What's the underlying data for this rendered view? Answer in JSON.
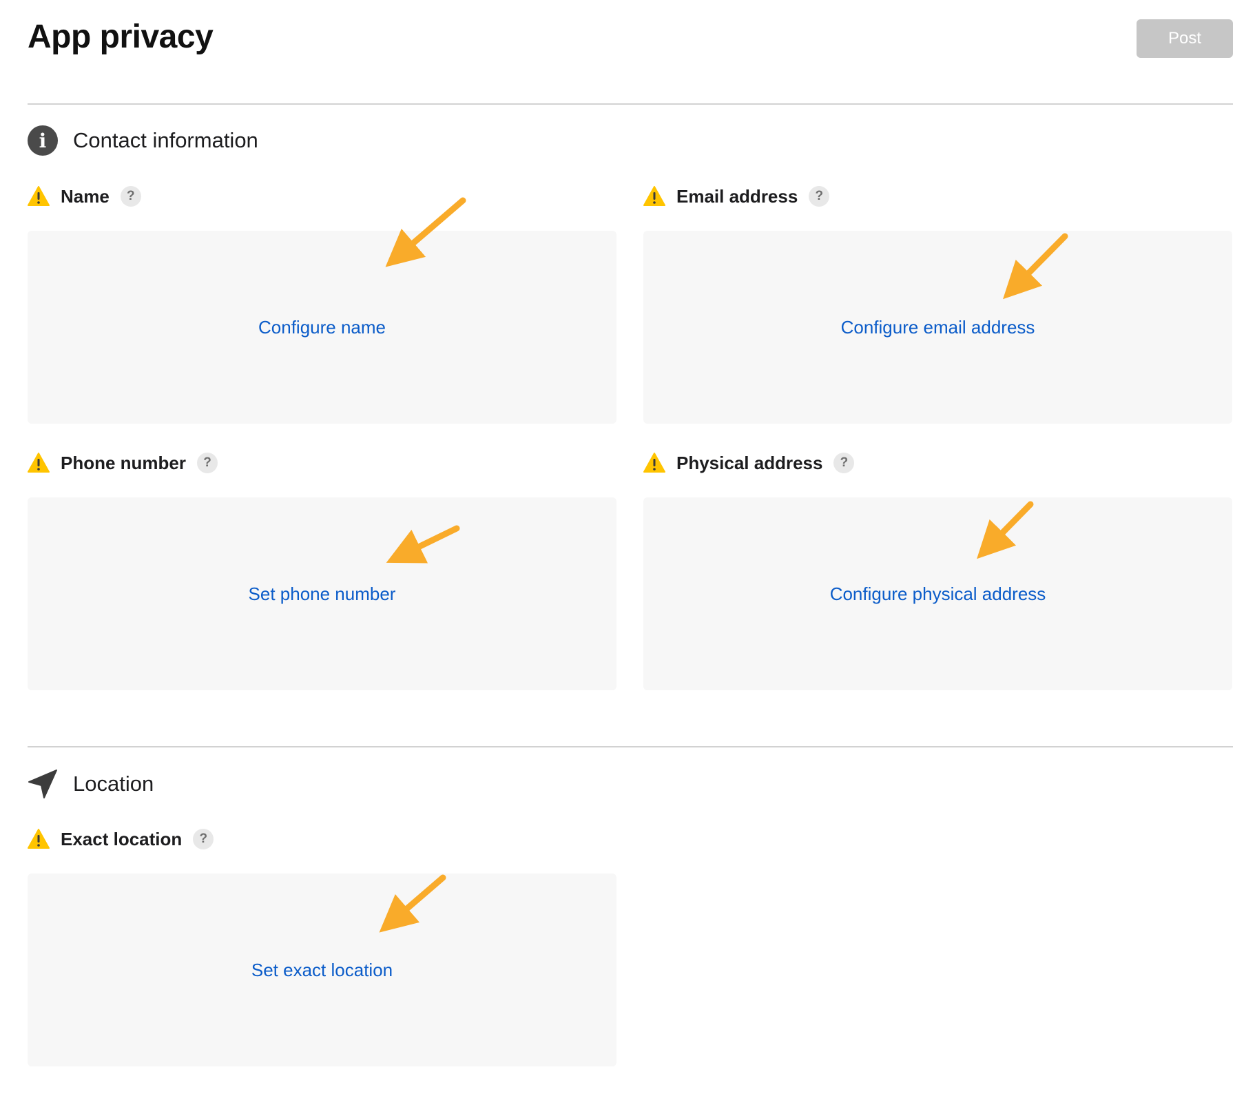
{
  "header": {
    "title": "App privacy",
    "post_label": "Post"
  },
  "sections": {
    "contact": {
      "title": "Contact information",
      "icon": "info-icon",
      "fields": {
        "name": {
          "label": "Name",
          "help": "?",
          "action": "Configure name"
        },
        "email": {
          "label": "Email address",
          "help": "?",
          "action": "Configure email address"
        },
        "phone": {
          "label": "Phone number",
          "help": "?",
          "action": "Set phone number"
        },
        "physical": {
          "label": "Physical address",
          "help": "?",
          "action": "Configure physical address"
        }
      }
    },
    "location": {
      "title": "Location",
      "icon": "location-arrow-icon",
      "fields": {
        "exact": {
          "label": "Exact location",
          "help": "?",
          "action": "Set exact location"
        }
      }
    }
  },
  "colors": {
    "link": "#0b5cc9",
    "warning": "#ffc400",
    "annotation_arrow": "#f9ab2a",
    "card_background": "#f7f7f7",
    "post_disabled": "#c6c6c6"
  }
}
